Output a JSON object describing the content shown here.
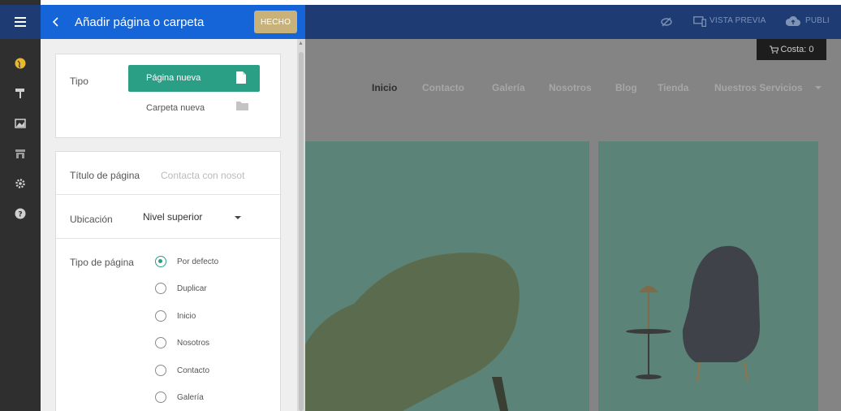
{
  "panel": {
    "title": "Añadir página o carpeta",
    "done_label": "HECHO",
    "type_label": "Tipo",
    "new_page_label": "Página nueva",
    "new_folder_label": "Carpeta nueva",
    "page_title_label": "Título de página",
    "page_title_placeholder": "Contacta con nosot",
    "location_label": "Ubicación",
    "location_value": "Nivel superior",
    "page_type_label": "Tipo de página",
    "page_type_options": [
      {
        "label": "Por defecto",
        "selected": true
      },
      {
        "label": "Duplicar",
        "selected": false
      },
      {
        "label": "Inicio",
        "selected": false
      },
      {
        "label": "Nosotros",
        "selected": false
      },
      {
        "label": "Contacto",
        "selected": false
      },
      {
        "label": "Galería",
        "selected": false
      }
    ]
  },
  "sidebar_icons": [
    "menu-icon",
    "globe-icon",
    "paint-roller-icon",
    "image-icon",
    "store-icon",
    "gear-icon",
    "help-icon"
  ],
  "topbar": {
    "preview_label": "VISTA PREVIA",
    "publish_label": "PUBLI"
  },
  "site": {
    "cart_label": "Costa: 0",
    "nav": [
      "Inicio",
      "Contacto",
      "Galería",
      "Nosotros",
      "Blog",
      "Tienda",
      "Nuestros Servicios"
    ],
    "active_nav": "Inicio"
  },
  "colors": {
    "header_blue": "#1565d8",
    "topbar_navy": "#1e3c73",
    "accent_teal": "#2b9e86",
    "done_gold": "#c8b27a"
  }
}
